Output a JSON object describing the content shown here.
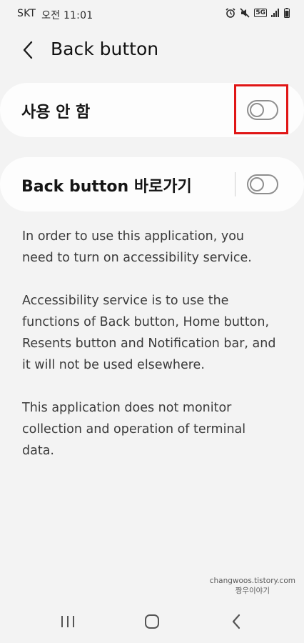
{
  "status_bar": {
    "carrier": "SKT",
    "time": "오전 11:01",
    "network_type": "5G",
    "icons": [
      "alarm-icon",
      "mute-icon",
      "network-5g-icon",
      "signal-icon",
      "battery-icon"
    ]
  },
  "app_bar": {
    "title": "Back button",
    "back_icon": "chevron-left-icon"
  },
  "settings": [
    {
      "label": "사용 안 함",
      "toggle_on": false
    },
    {
      "label": "Back button 바로가기",
      "toggle_on": false
    }
  ],
  "description": [
    "In order to use this application, you need to turn on accessibility service.",
    "Accessibility service is to use the functions of Back button, Home button, Resents button and Notification bar, and it will not be used elsewhere.",
    "This application does not monitor collection and operation of terminal data."
  ],
  "watermark": {
    "line1": "changwoos.tistory.com",
    "line2": "짱우이야기"
  },
  "nav_bar": {
    "icons": [
      "recents-icon",
      "home-icon",
      "back-icon"
    ]
  },
  "colors": {
    "background": "#f3f3f3",
    "card": "#fdfdfd",
    "highlight": "#e01616",
    "toggle_off": "#8e8e8e"
  }
}
